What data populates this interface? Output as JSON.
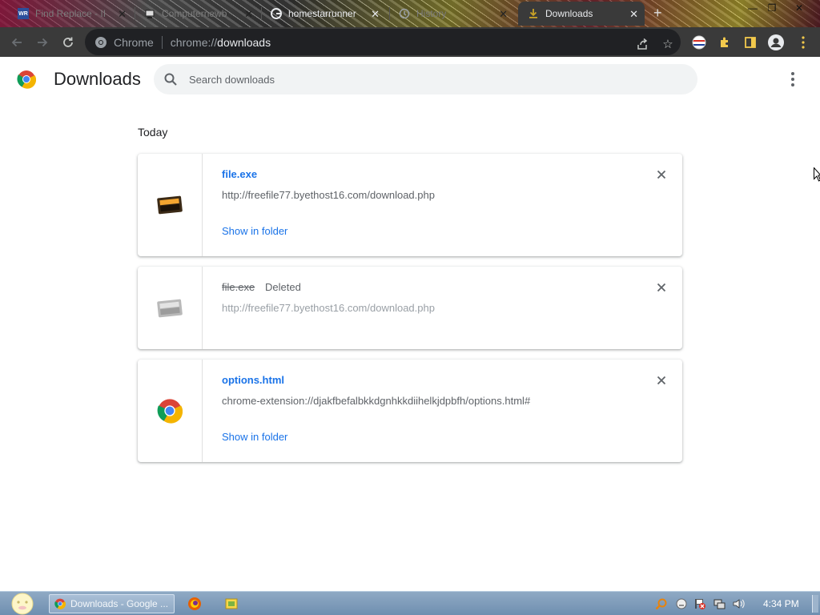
{
  "tabs": [
    {
      "label": "Find Replace - II",
      "favicon": "wr-icon",
      "active": false
    },
    {
      "label": "Computernewb",
      "favicon": "computernewb-icon",
      "active": false
    },
    {
      "label": "homestarrunner",
      "favicon": "google-icon",
      "active": false
    },
    {
      "label": "History",
      "favicon": "history-icon",
      "active": false
    },
    {
      "label": "Downloads",
      "favicon": "download-icon",
      "active": true
    }
  ],
  "toolbar": {
    "chip_label": "Chrome",
    "url_scheme": "chrome://",
    "url_host": "downloads"
  },
  "page": {
    "title": "Downloads",
    "search_placeholder": "Search downloads",
    "section_date": "Today"
  },
  "downloads": [
    {
      "filename": "file.exe",
      "status": "",
      "url": "http://freefile77.byethost16.com/download.php",
      "action": "Show in folder",
      "icon": "exe-file-icon"
    },
    {
      "filename": "file.exe",
      "status": "Deleted",
      "url": "http://freefile77.byethost16.com/download.php",
      "action": "",
      "icon": "exe-file-icon-faded"
    },
    {
      "filename": "options.html",
      "status": "",
      "url": "chrome-extension://djakfbefalbkkdgnhkkdiihelkjdpbfh/options.html#",
      "action": "Show in folder",
      "icon": "chrome-icon"
    }
  ],
  "taskbar": {
    "active_task": "Downloads - Google ...",
    "clock": "4:34 PM"
  },
  "colors": {
    "link": "#1a73e8",
    "toolbar_bg": "#3a3a3a",
    "taskbar_bg": "#7f9bb9"
  }
}
